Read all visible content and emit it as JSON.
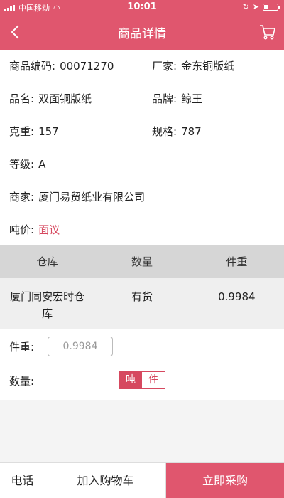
{
  "status_bar": {
    "carrier": "中国移动",
    "time": "10:01"
  },
  "nav": {
    "title": "商品详情"
  },
  "info": {
    "code_label": "商品编码:",
    "code_value": "00071270",
    "maker_label": "厂家:",
    "maker_value": "金东铜版纸",
    "name_label": "品名:",
    "name_value": "双面铜版纸",
    "brand_label": "品牌:",
    "brand_value": "鲸王",
    "weight_label": "克重:",
    "weight_value": "157",
    "spec_label": "规格:",
    "spec_value": "787",
    "grade_label": "等级:",
    "grade_value": "A",
    "merchant_label": "商家:",
    "merchant_value": "厦门易贸纸业有限公司",
    "price_label": "吨价:",
    "price_value": "面议"
  },
  "stock_table": {
    "headers": [
      "仓库",
      "数量",
      "件重"
    ],
    "rows": [
      {
        "warehouse_line1": "厦门同安宏时仓",
        "warehouse_line2": "库",
        "quantity": "有货",
        "piece_weight": "0.9984"
      }
    ]
  },
  "form": {
    "piece_weight_label": "件重:",
    "piece_weight_value": "0.9984",
    "quantity_label": "数量:",
    "quantity_value": "",
    "unit_ton": "吨",
    "unit_piece": "件"
  },
  "bottom": {
    "phone": "电话",
    "add_cart": "加入购物车",
    "buy_now": "立即采购"
  },
  "colors": {
    "accent": "#e0566e",
    "price_red": "#d6485f"
  }
}
